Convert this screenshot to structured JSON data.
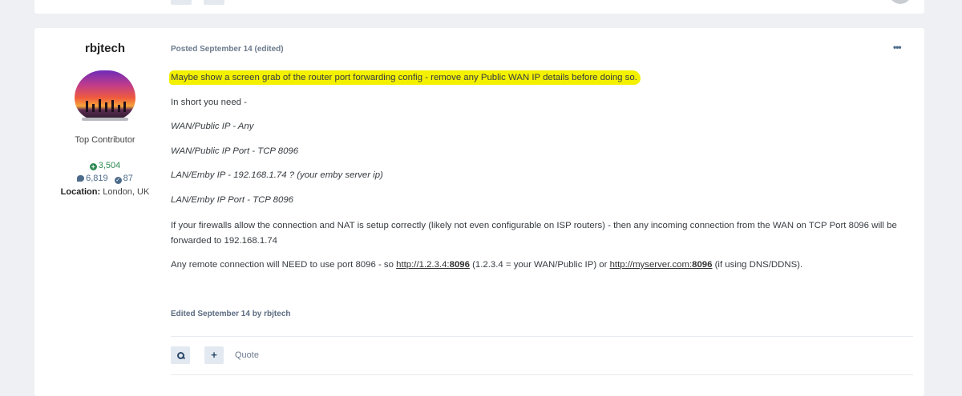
{
  "author": {
    "name": "rbjtech",
    "title": "Top Contributor",
    "reputation": "3,504",
    "posts": "6,819",
    "solutions": "87",
    "location_label": "Location:",
    "location_value": "London, UK"
  },
  "post": {
    "meta": "Posted September 14 (edited)",
    "more": "•••",
    "highlight_line": "Maybe show a screen grab of the router port forwarding config - remove any Public WAN IP details before doing so.",
    "intro": "In short you need -",
    "items": [
      "WAN/Public IP - Any",
      "WAN/Public IP Port - TCP 8096",
      "LAN/Emby IP - 192.168.1.74 ? (your emby server ip)",
      "LAN/Emby IP Port - TCP 8096"
    ],
    "firewall_text": "If your firewalls allow the connection and NAT is setup correctly (likely not even configurable on ISP routers) - then any incoming connection from the WAN on TCP Port 8096 will be forwarded to 192.168.1.74",
    "remote": {
      "prefix": "Any remote connection will NEED to use port 8096 - so ",
      "link1_text": "http://1.2.3.4:",
      "link1_bold": "8096",
      "middle": " (1.2.3.4 = your WAN/Public IP) or ",
      "link2_text": "http://myserver.com:",
      "link2_bold": "8096",
      "suffix": " (if using DNS/DDNS)."
    },
    "edited": "Edited September 14 by rbjtech",
    "quote_label": "Quote",
    "highlight_color": "#f3f000"
  },
  "icons": {
    "search": "search-icon",
    "plus": "plus-icon",
    "more": "ellipsis-icon"
  }
}
